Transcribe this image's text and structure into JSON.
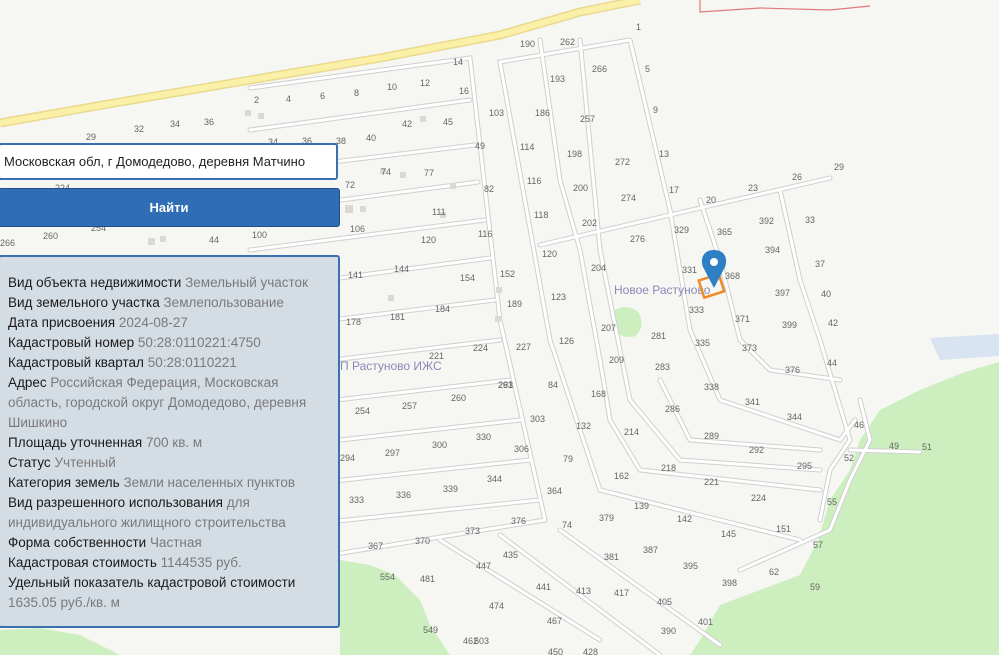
{
  "search": {
    "value": "Московская обл, г Домодедово, деревня Матчино"
  },
  "find_button": {
    "label": "Найти"
  },
  "info": [
    {
      "label": "Вид объекта недвижимости",
      "value": "Земельный участок"
    },
    {
      "label": "Вид земельного участка",
      "value": "Землепользование"
    },
    {
      "label": "Дата присвоения",
      "value": "2024-08-27"
    },
    {
      "label": "Кадастровый номер",
      "value": "50:28:0110221:4750"
    },
    {
      "label": "Кадастровый квартал",
      "value": "50:28:0110221"
    },
    {
      "label": "Адрес",
      "value": "Российская Федерация, Московская область, городской округ Домодедово, деревня Шишкино"
    },
    {
      "label": "Площадь уточненная",
      "value": "700 кв. м"
    },
    {
      "label": "Статус",
      "value": "Учтенный"
    },
    {
      "label": "Категория земель",
      "value": "Земли населенных пунктов"
    },
    {
      "label": "Вид разрешенного использования",
      "value": "для индивидуального жилищного строительства"
    },
    {
      "label": "Форма собственности",
      "value": "Частная"
    },
    {
      "label": "Кадастровая стоимость",
      "value": "1144535 руб."
    },
    {
      "label": "Удельный показатель кадастровой стоимости",
      "value": "1635.05 руб./кв. м"
    }
  ],
  "map": {
    "place_novoe": "Новое Растуново",
    "place_izhs": "П Растуново ИЖС",
    "parcel_numbers": [
      "1",
      "5",
      "9",
      "13",
      "17",
      "20",
      "23",
      "26",
      "29",
      "262",
      "266",
      "190",
      "193",
      "186",
      "257",
      "272",
      "274",
      "198",
      "200",
      "202",
      "114",
      "116",
      "118",
      "103",
      "49",
      "82",
      "116",
      "14",
      "16",
      "120",
      "123",
      "126",
      "84",
      "79",
      "303",
      "306",
      "263",
      "204",
      "207",
      "209",
      "214",
      "218",
      "221",
      "224",
      "168",
      "162",
      "132",
      "139",
      "142",
      "145",
      "151",
      "276",
      "281",
      "283",
      "286",
      "289",
      "292",
      "295",
      "329",
      "331",
      "333",
      "335",
      "338",
      "341",
      "344",
      "365",
      "368",
      "371",
      "373",
      "376",
      "392",
      "394",
      "397",
      "399",
      "33",
      "37",
      "40",
      "42",
      "44",
      "46",
      "49",
      "51",
      "52",
      "55",
      "57",
      "59",
      "62",
      "2",
      "4",
      "6",
      "8",
      "10",
      "12",
      "32",
      "34",
      "36",
      "29",
      "42",
      "45",
      "40",
      "38",
      "36",
      "34",
      "74",
      "77",
      "72",
      "111",
      "106",
      "120",
      "100",
      "44",
      "260",
      "254",
      "266",
      "224",
      "141",
      "144",
      "154",
      "152",
      "178",
      "181",
      "184",
      "189",
      "221",
      "224",
      "227",
      "254",
      "257",
      "260",
      "291",
      "294",
      "297",
      "300",
      "330",
      "333",
      "336",
      "339",
      "344",
      "364",
      "367",
      "370",
      "373",
      "376",
      "74",
      "379",
      "381",
      "387",
      "395",
      "398",
      "401",
      "390",
      "405",
      "417",
      "413",
      "435",
      "441",
      "447",
      "467",
      "474",
      "481",
      "503",
      "549",
      "554",
      "462",
      "450",
      "428"
    ],
    "colors": {
      "water": "#d8e4f2",
      "forest": "#cdefbf",
      "road": "#fbf0a8",
      "parcel": "#f08a24",
      "marker": "#2f7fc4"
    }
  }
}
